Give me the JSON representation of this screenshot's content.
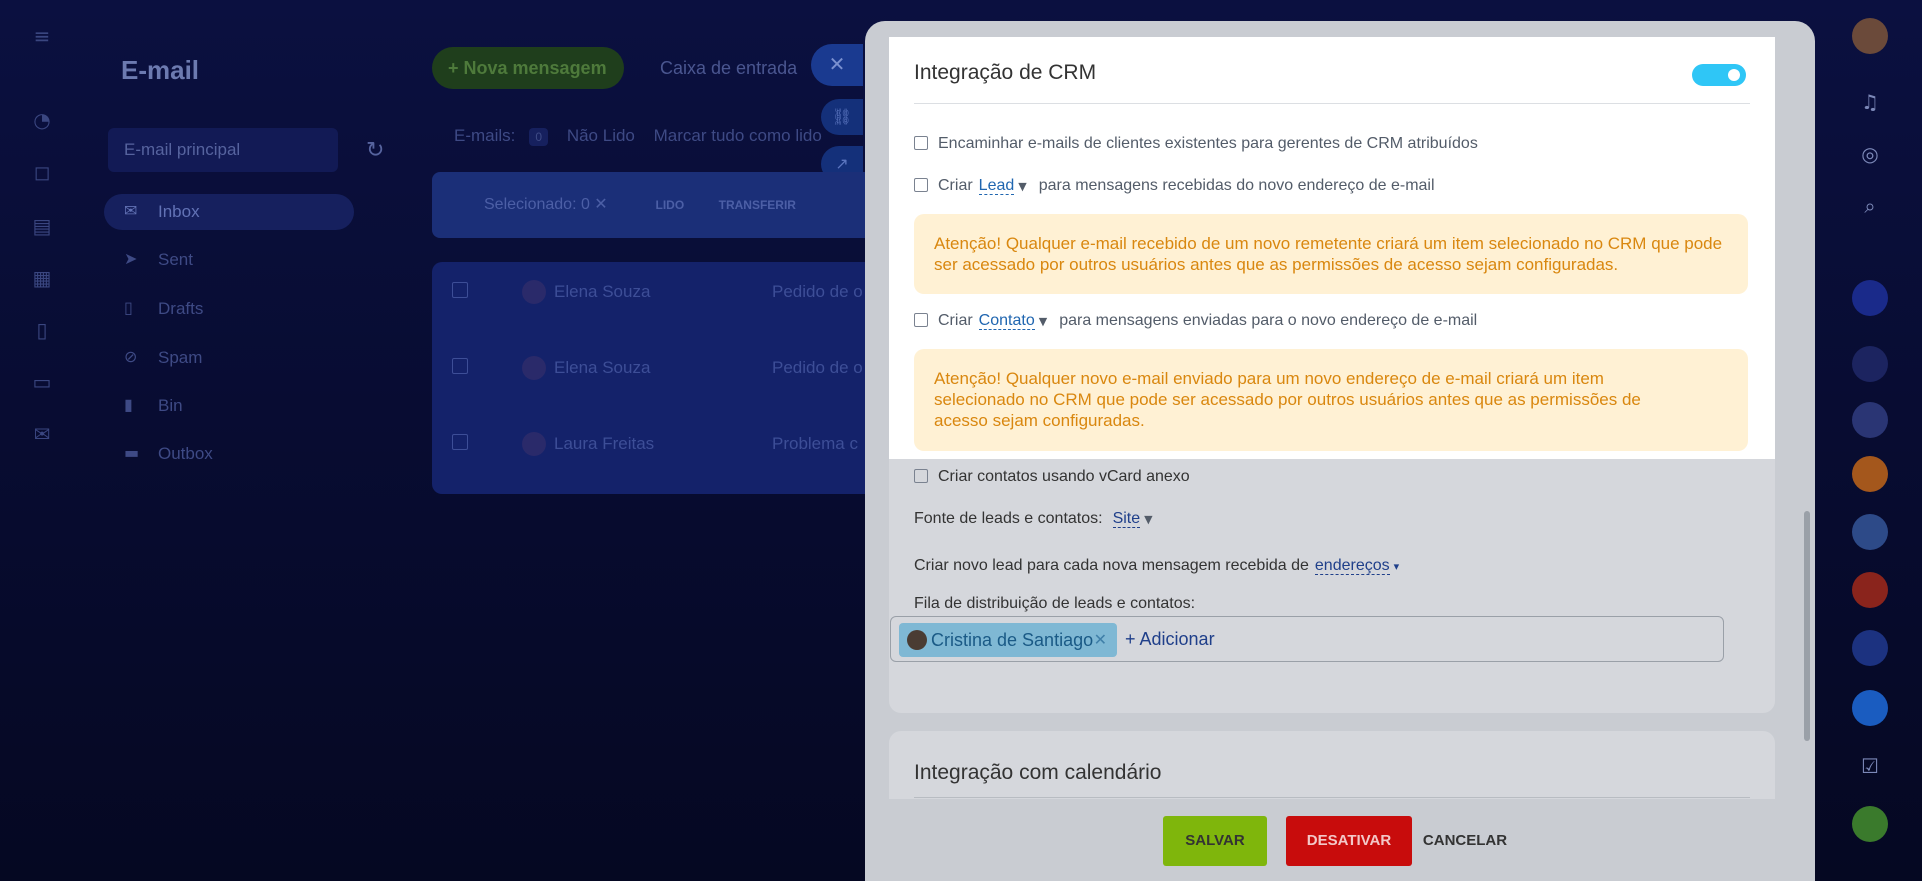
{
  "app": {
    "title": "E-mail",
    "mailbox": "E-mail principal",
    "new_message_label": "Nova mensagem",
    "inbox_tab": "Caixa de entrada",
    "filter_prefix": "E-mails:",
    "filter_count": "0",
    "filter_unread": "Não Lido",
    "mark_all_read": "Marcar tudo como lido",
    "selected_label": "Selecionado: 0",
    "read_label": "LIDO",
    "move_label": "TRANSFERIR"
  },
  "folders": [
    {
      "label": "Inbox",
      "icon": "envelope-icon"
    },
    {
      "label": "Sent",
      "icon": "sent-icon"
    },
    {
      "label": "Drafts",
      "icon": "draft-icon"
    },
    {
      "label": "Spam",
      "icon": "spam-icon"
    },
    {
      "label": "Bin",
      "icon": "trash-icon"
    },
    {
      "label": "Outbox",
      "icon": "outbox-icon"
    }
  ],
  "messages": [
    {
      "initials": "ES",
      "sender": "Elena Souza",
      "subject": "Pedido de o"
    },
    {
      "initials": "ES",
      "sender": "Elena Souza",
      "subject": "Pedido de o"
    },
    {
      "initials": "LF",
      "sender": "Laura Freitas",
      "subject": "Problema c"
    }
  ],
  "crm": {
    "title": "Integração de CRM",
    "forward_existing": "Encaminhar e-mails de clientes existentes para gerentes de CRM atribuídos",
    "create_label": "Criar",
    "incoming_entity": "Lead",
    "incoming_suffix": "para mensagens recebidas do novo endereço de e-mail",
    "incoming_warning": "Atenção! Qualquer e-mail recebido de um novo remetente criará um item selecionado no CRM que pode ser acessado por outros usuários antes que as permissões de acesso sejam configuradas.",
    "outgoing_entity": "Contato",
    "outgoing_suffix": "para mensagens enviadas para o novo endereço de e-mail",
    "outgoing_warning": "Atenção! Qualquer novo e-mail enviado para um novo endereço de e-mail criará um item selecionado no CRM que pode ser acessado por outros usuários antes que as permissões de acesso sejam configuradas.",
    "vcard": "Criar contatos usando vCard anexo",
    "source_label": "Fonte de leads e contatos:",
    "source_value": "Site",
    "new_lead_prefix": "Criar novo lead para cada nova mensagem recebida de",
    "new_lead_value": "endereços",
    "queue_label": "Fila de distribuição de leads e contatos:",
    "queue_user": "Cristina de Santiago",
    "add_label": "+ Adicionar"
  },
  "calendar": {
    "title": "Integração com calendário"
  },
  "footer": {
    "save": "SALVAR",
    "disable": "DESATIVAR",
    "cancel": "CANCELAR"
  },
  "colors": {
    "toggle_on": "#2fc6f6",
    "save": "#7fb60c",
    "disable": "#c80c0c",
    "warning_bg": "#fff1d4",
    "warning_text": "#d9870f",
    "link": "#2066b0"
  }
}
